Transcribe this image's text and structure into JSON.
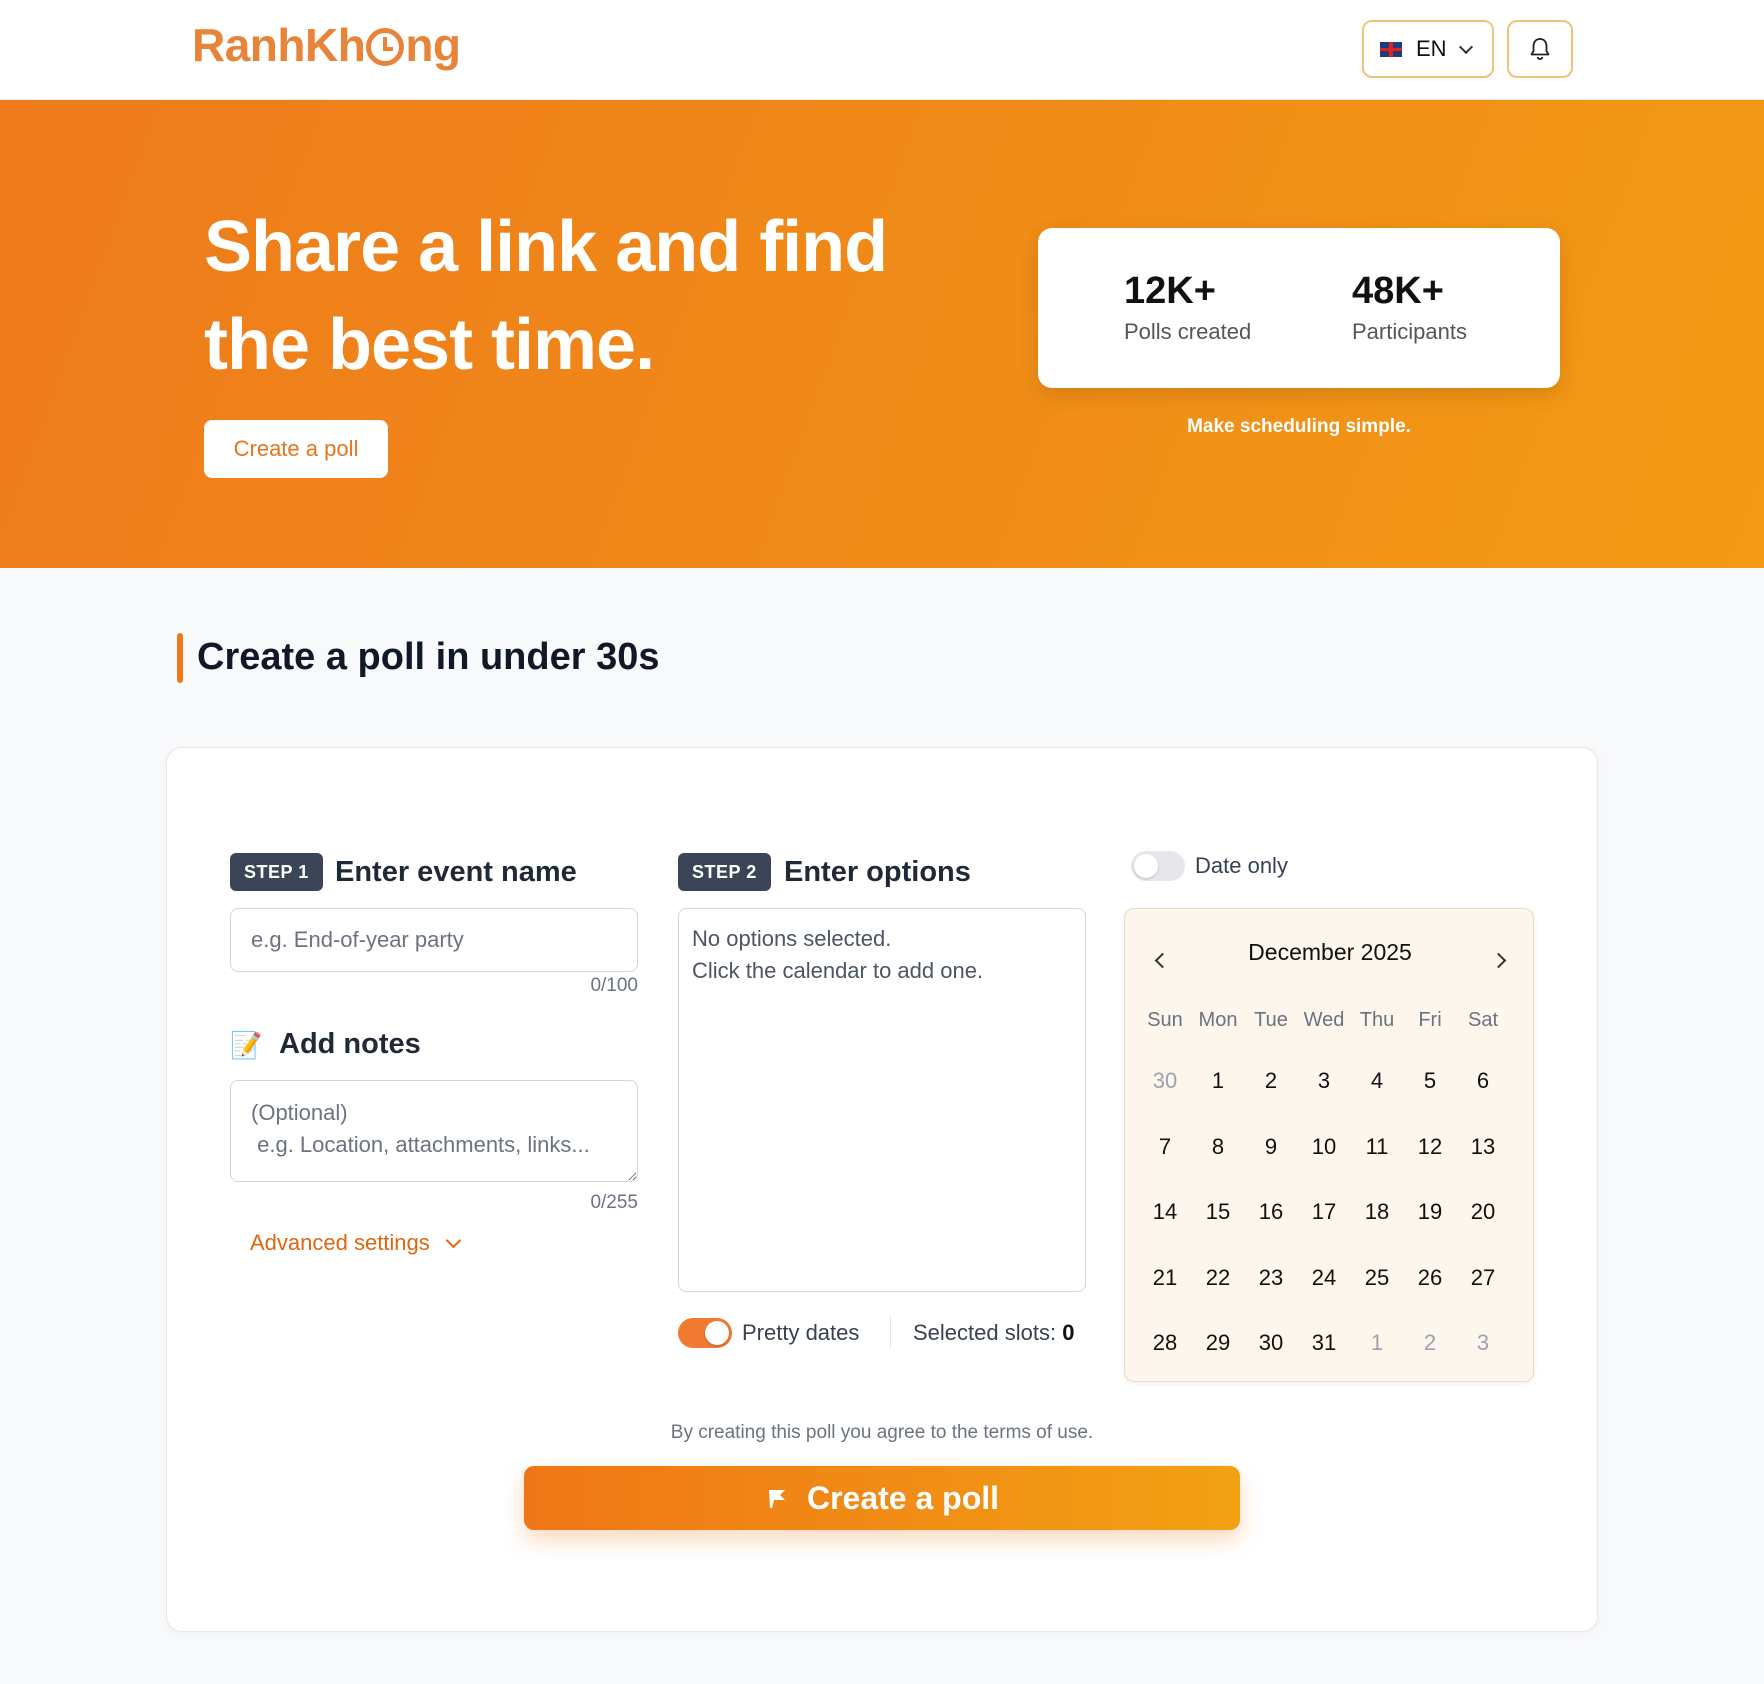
{
  "header": {
    "logo": "RanhKhông",
    "logo_parts": [
      "RanhKh",
      "ng"
    ],
    "language": "EN",
    "icons": {
      "flag": "uk-flag-icon",
      "chevron": "chevron-down-icon",
      "bell": "bell-icon"
    }
  },
  "hero": {
    "title": "Share a link and find the best time.",
    "cta": "Create a poll",
    "stats": [
      {
        "value": "12K+",
        "label": "Polls created"
      },
      {
        "value": "48K+",
        "label": "Participants"
      }
    ],
    "caption": "Make scheduling simple.",
    "colors": {
      "gradient_start": "#ee7a1c",
      "gradient_end": "#f29a14"
    }
  },
  "section": {
    "title": "Create a poll in under 30s"
  },
  "form": {
    "step1": {
      "badge": "STEP 1",
      "title": "Enter event name",
      "placeholder": "e.g. End-of-year party",
      "counter": "0/100"
    },
    "notes": {
      "icon": "memo-icon",
      "title": "Add notes",
      "placeholder": "(Optional)\n e.g. Location, attachments, links...",
      "counter": "0/255"
    },
    "advanced": "Advanced settings",
    "step2": {
      "badge": "STEP 2",
      "title": "Enter options",
      "empty_line1": "No options selected.",
      "empty_line2": "Click the calendar to add one."
    },
    "pretty_dates": {
      "label": "Pretty dates",
      "on": true
    },
    "selected_slots": {
      "label": "Selected slots:",
      "count": "0"
    },
    "date_only": {
      "label": "Date only",
      "on": false
    }
  },
  "calendar": {
    "month": "December 2025",
    "weekdays": [
      "Sun",
      "Mon",
      "Tue",
      "Wed",
      "Thu",
      "Fri",
      "Sat"
    ],
    "weeks": [
      [
        "30",
        "1",
        "2",
        "3",
        "4",
        "5",
        "6"
      ],
      [
        "7",
        "8",
        "9",
        "10",
        "11",
        "12",
        "13"
      ],
      [
        "14",
        "15",
        "16",
        "17",
        "18",
        "19",
        "20"
      ],
      [
        "21",
        "22",
        "23",
        "24",
        "25",
        "26",
        "27"
      ],
      [
        "28",
        "29",
        "30",
        "31",
        "1",
        "2",
        "3"
      ]
    ],
    "outside_month": [
      [
        0,
        0
      ],
      [
        4,
        4
      ],
      [
        4,
        5
      ],
      [
        4,
        6
      ]
    ]
  },
  "footer": {
    "terms": "By creating this poll you agree to the terms of use.",
    "create_button": "Create a poll",
    "create_icon": "flag-icon"
  }
}
